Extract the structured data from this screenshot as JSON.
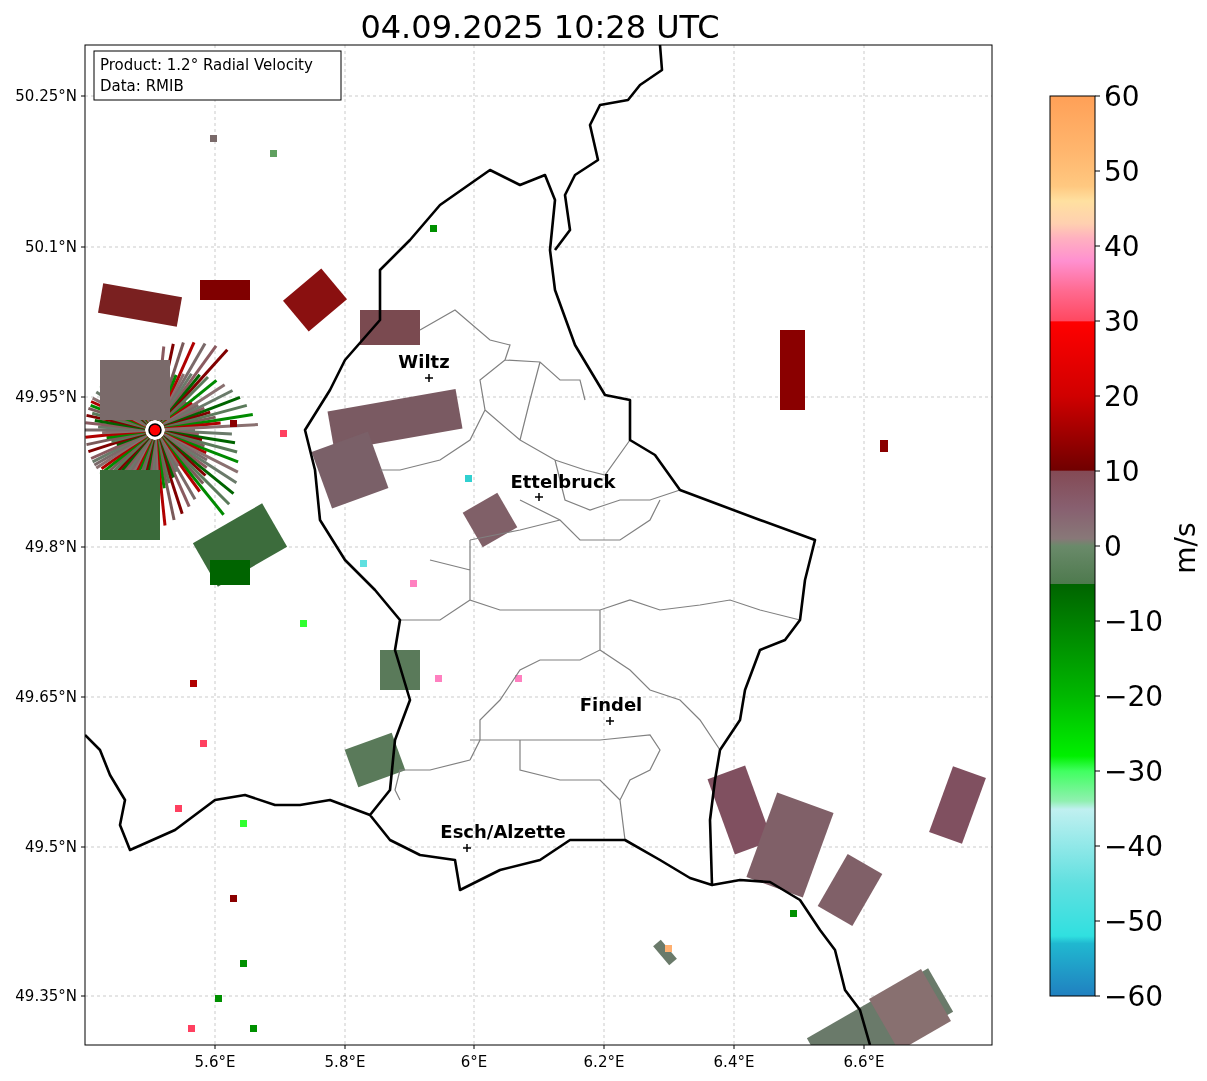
{
  "title": "04.09.2025 10:28 UTC",
  "info_box": [
    "Product: 1.2° Radial Velocity",
    "Data: RMIB"
  ],
  "map": {
    "y_ticks": [
      "50.25°N",
      "50.1°N",
      "49.95°N",
      "49.8°N",
      "49.65°N",
      "49.5°N",
      "49.35°N"
    ],
    "x_ticks": [
      "5.6°E",
      "5.8°E",
      "6°E",
      "6.2°E",
      "6.4°E",
      "6.6°E"
    ],
    "cities": [
      {
        "name": "Wiltz"
      },
      {
        "name": "Ettelbruck"
      },
      {
        "name": "Findel"
      },
      {
        "name": "Esch/Alzette"
      }
    ]
  },
  "colorbar": {
    "label": "m/s",
    "ticks": [
      "60",
      "50",
      "40",
      "30",
      "20",
      "10",
      "0",
      "−10",
      "−20",
      "−30",
      "−40",
      "−50",
      "−60"
    ]
  }
}
